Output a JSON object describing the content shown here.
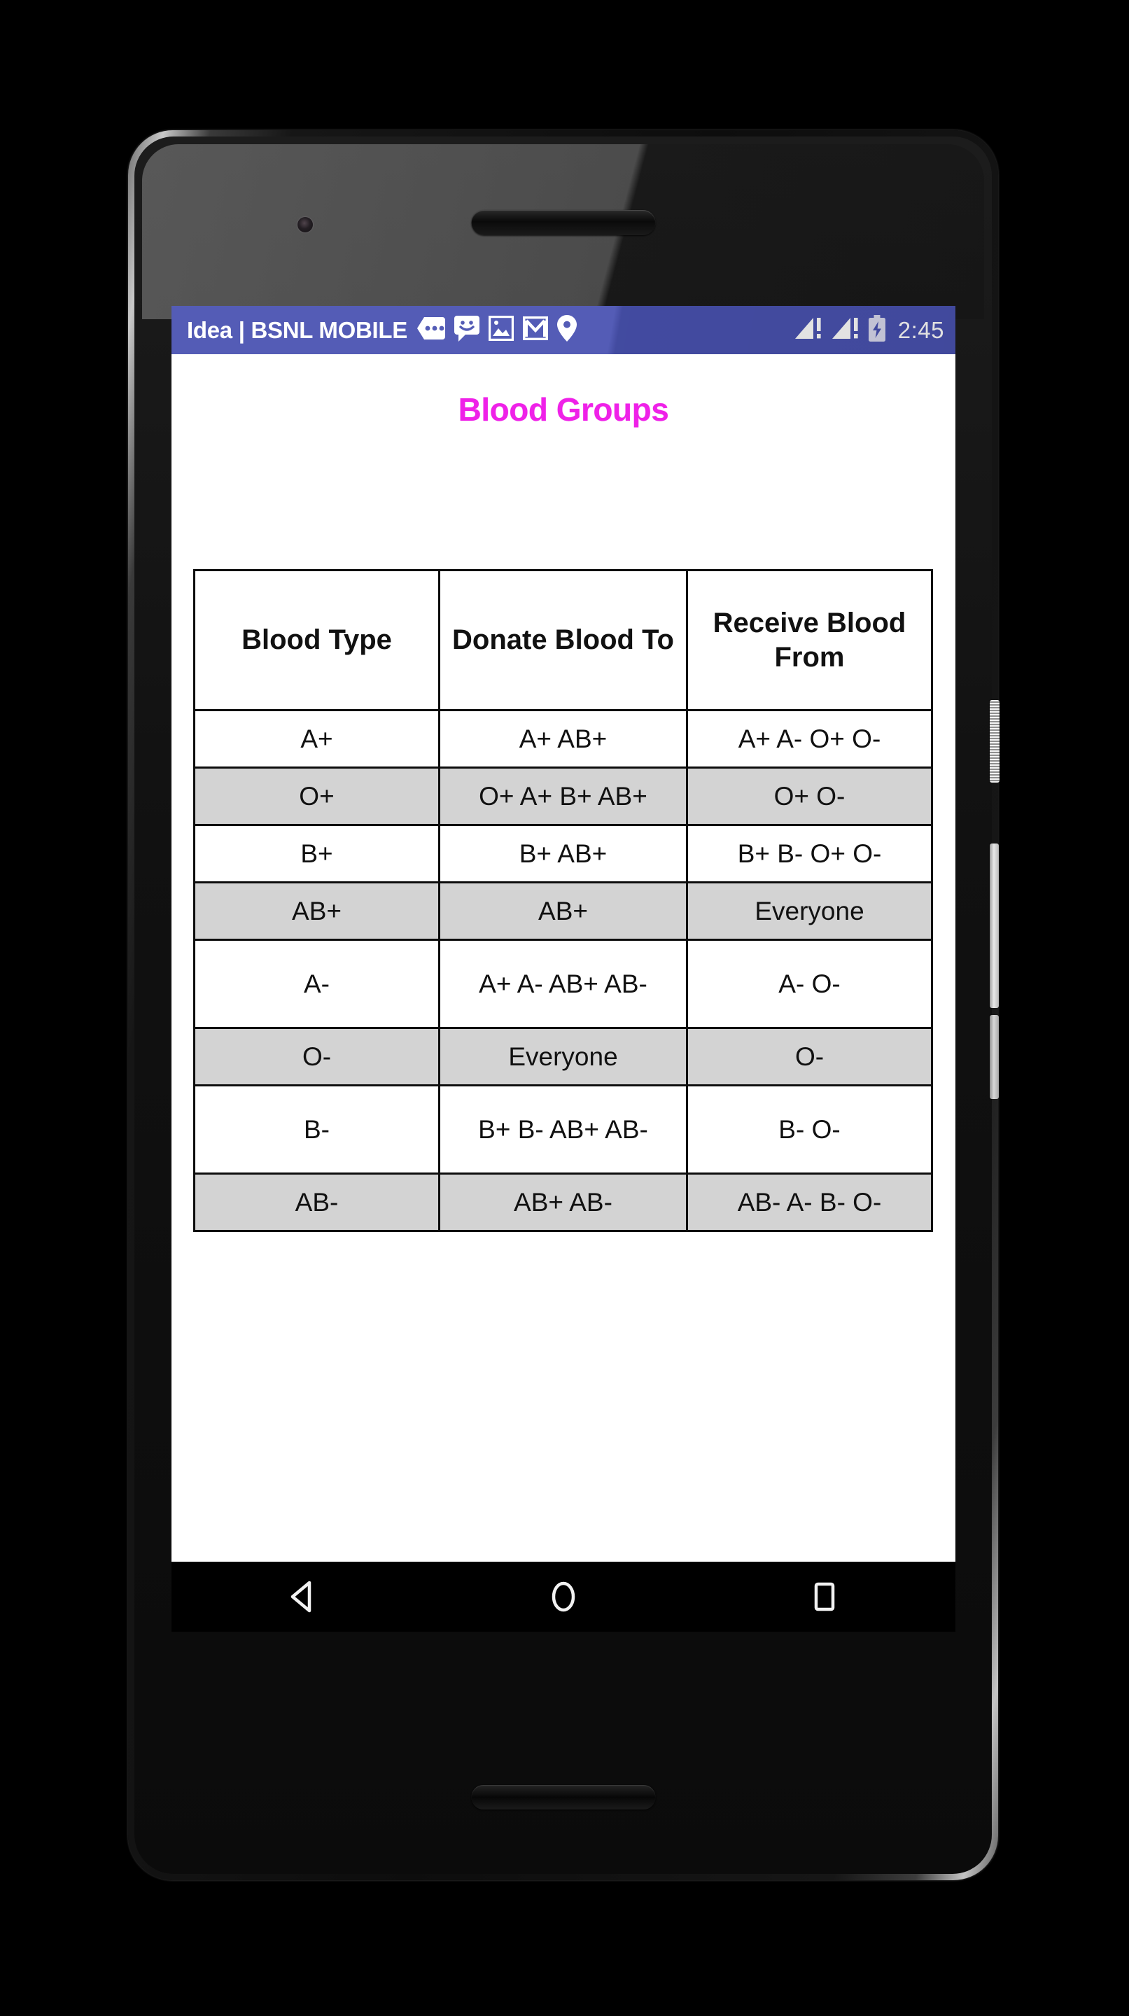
{
  "status_bar": {
    "carrier": "Idea | BSNL MOBILE",
    "clock": "2:45",
    "background_color": "#4a53b2",
    "icons_left": [
      {
        "name": "hangouts-icon",
        "label": "Hangouts"
      },
      {
        "name": "messages-smiley-icon",
        "label": "Messages"
      },
      {
        "name": "photos-image-icon",
        "label": "Photos"
      },
      {
        "name": "gmail-icon",
        "label": "Gmail"
      },
      {
        "name": "location-pin-icon",
        "label": "Location"
      }
    ],
    "icons_right": [
      {
        "name": "signal-sim1-alert-icon",
        "label": "Signal SIM 1 - no service"
      },
      {
        "name": "signal-sim2-alert-icon",
        "label": "Signal SIM 2 - no service"
      },
      {
        "name": "battery-charging-icon",
        "label": "Battery charging"
      }
    ]
  },
  "app": {
    "title": "Blood Groups",
    "title_color": "#ef21e8",
    "row_alt_color": "#d3d3d3"
  },
  "table": {
    "headers": [
      "Blood\nType",
      "Donate\nBlood To",
      "Receive\nBlood\nFrom"
    ],
    "headers_flat": {
      "blood_type": "Blood Type",
      "donate_blood_to": "Donate Blood To",
      "receive_blood_from": "Receive Blood From"
    },
    "rows": [
      {
        "type": "A+",
        "donate_to": "A+ AB+",
        "receive_from": "A+ A- O+ O-",
        "shaded": false
      },
      {
        "type": "O+",
        "donate_to": "O+ A+ B+ AB+",
        "receive_from": "O+ O-",
        "shaded": true
      },
      {
        "type": "B+",
        "donate_to": "B+ AB+",
        "receive_from": "B+ B- O+ O-",
        "shaded": false
      },
      {
        "type": "AB+",
        "donate_to": "AB+",
        "receive_from": "Everyone",
        "shaded": true
      },
      {
        "type": "A-",
        "donate_to": "A+ A- AB+ AB-",
        "receive_from": "A- O-",
        "shaded": false
      },
      {
        "type": "O-",
        "donate_to": "Everyone",
        "receive_from": "O-",
        "shaded": true
      },
      {
        "type": "B-",
        "donate_to": "B+ B- AB+ AB-",
        "receive_from": "B- O-",
        "shaded": false
      },
      {
        "type": "AB-",
        "donate_to": "AB+ AB-",
        "receive_from": "AB- A- B- O-",
        "shaded": true
      }
    ]
  },
  "nav_bar": {
    "buttons": [
      {
        "name": "back-button",
        "label": "Back"
      },
      {
        "name": "home-button",
        "label": "Home"
      },
      {
        "name": "recents-button",
        "label": "Recent apps"
      }
    ]
  }
}
